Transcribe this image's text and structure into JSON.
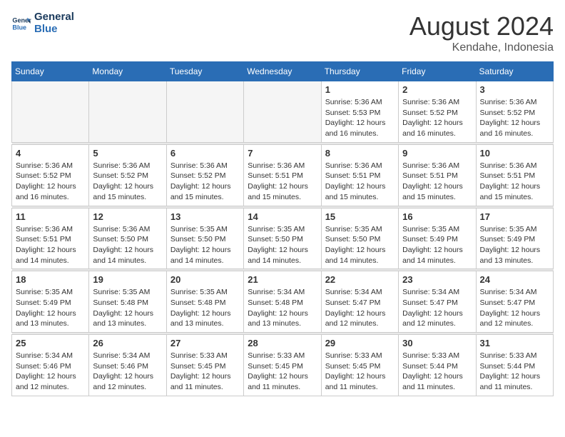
{
  "header": {
    "logo_line1": "General",
    "logo_line2": "Blue",
    "month_year": "August 2024",
    "location": "Kendahe, Indonesia"
  },
  "weekdays": [
    "Sunday",
    "Monday",
    "Tuesday",
    "Wednesday",
    "Thursday",
    "Friday",
    "Saturday"
  ],
  "weeks": [
    [
      {
        "day": "",
        "info": ""
      },
      {
        "day": "",
        "info": ""
      },
      {
        "day": "",
        "info": ""
      },
      {
        "day": "",
        "info": ""
      },
      {
        "day": "1",
        "info": "Sunrise: 5:36 AM\nSunset: 5:53 PM\nDaylight: 12 hours\nand 16 minutes."
      },
      {
        "day": "2",
        "info": "Sunrise: 5:36 AM\nSunset: 5:52 PM\nDaylight: 12 hours\nand 16 minutes."
      },
      {
        "day": "3",
        "info": "Sunrise: 5:36 AM\nSunset: 5:52 PM\nDaylight: 12 hours\nand 16 minutes."
      }
    ],
    [
      {
        "day": "4",
        "info": "Sunrise: 5:36 AM\nSunset: 5:52 PM\nDaylight: 12 hours\nand 16 minutes."
      },
      {
        "day": "5",
        "info": "Sunrise: 5:36 AM\nSunset: 5:52 PM\nDaylight: 12 hours\nand 15 minutes."
      },
      {
        "day": "6",
        "info": "Sunrise: 5:36 AM\nSunset: 5:52 PM\nDaylight: 12 hours\nand 15 minutes."
      },
      {
        "day": "7",
        "info": "Sunrise: 5:36 AM\nSunset: 5:51 PM\nDaylight: 12 hours\nand 15 minutes."
      },
      {
        "day": "8",
        "info": "Sunrise: 5:36 AM\nSunset: 5:51 PM\nDaylight: 12 hours\nand 15 minutes."
      },
      {
        "day": "9",
        "info": "Sunrise: 5:36 AM\nSunset: 5:51 PM\nDaylight: 12 hours\nand 15 minutes."
      },
      {
        "day": "10",
        "info": "Sunrise: 5:36 AM\nSunset: 5:51 PM\nDaylight: 12 hours\nand 15 minutes."
      }
    ],
    [
      {
        "day": "11",
        "info": "Sunrise: 5:36 AM\nSunset: 5:51 PM\nDaylight: 12 hours\nand 14 minutes."
      },
      {
        "day": "12",
        "info": "Sunrise: 5:36 AM\nSunset: 5:50 PM\nDaylight: 12 hours\nand 14 minutes."
      },
      {
        "day": "13",
        "info": "Sunrise: 5:35 AM\nSunset: 5:50 PM\nDaylight: 12 hours\nand 14 minutes."
      },
      {
        "day": "14",
        "info": "Sunrise: 5:35 AM\nSunset: 5:50 PM\nDaylight: 12 hours\nand 14 minutes."
      },
      {
        "day": "15",
        "info": "Sunrise: 5:35 AM\nSunset: 5:50 PM\nDaylight: 12 hours\nand 14 minutes."
      },
      {
        "day": "16",
        "info": "Sunrise: 5:35 AM\nSunset: 5:49 PM\nDaylight: 12 hours\nand 14 minutes."
      },
      {
        "day": "17",
        "info": "Sunrise: 5:35 AM\nSunset: 5:49 PM\nDaylight: 12 hours\nand 13 minutes."
      }
    ],
    [
      {
        "day": "18",
        "info": "Sunrise: 5:35 AM\nSunset: 5:49 PM\nDaylight: 12 hours\nand 13 minutes."
      },
      {
        "day": "19",
        "info": "Sunrise: 5:35 AM\nSunset: 5:48 PM\nDaylight: 12 hours\nand 13 minutes."
      },
      {
        "day": "20",
        "info": "Sunrise: 5:35 AM\nSunset: 5:48 PM\nDaylight: 12 hours\nand 13 minutes."
      },
      {
        "day": "21",
        "info": "Sunrise: 5:34 AM\nSunset: 5:48 PM\nDaylight: 12 hours\nand 13 minutes."
      },
      {
        "day": "22",
        "info": "Sunrise: 5:34 AM\nSunset: 5:47 PM\nDaylight: 12 hours\nand 12 minutes."
      },
      {
        "day": "23",
        "info": "Sunrise: 5:34 AM\nSunset: 5:47 PM\nDaylight: 12 hours\nand 12 minutes."
      },
      {
        "day": "24",
        "info": "Sunrise: 5:34 AM\nSunset: 5:47 PM\nDaylight: 12 hours\nand 12 minutes."
      }
    ],
    [
      {
        "day": "25",
        "info": "Sunrise: 5:34 AM\nSunset: 5:46 PM\nDaylight: 12 hours\nand 12 minutes."
      },
      {
        "day": "26",
        "info": "Sunrise: 5:34 AM\nSunset: 5:46 PM\nDaylight: 12 hours\nand 12 minutes."
      },
      {
        "day": "27",
        "info": "Sunrise: 5:33 AM\nSunset: 5:45 PM\nDaylight: 12 hours\nand 11 minutes."
      },
      {
        "day": "28",
        "info": "Sunrise: 5:33 AM\nSunset: 5:45 PM\nDaylight: 12 hours\nand 11 minutes."
      },
      {
        "day": "29",
        "info": "Sunrise: 5:33 AM\nSunset: 5:45 PM\nDaylight: 12 hours\nand 11 minutes."
      },
      {
        "day": "30",
        "info": "Sunrise: 5:33 AM\nSunset: 5:44 PM\nDaylight: 12 hours\nand 11 minutes."
      },
      {
        "day": "31",
        "info": "Sunrise: 5:33 AM\nSunset: 5:44 PM\nDaylight: 12 hours\nand 11 minutes."
      }
    ]
  ]
}
